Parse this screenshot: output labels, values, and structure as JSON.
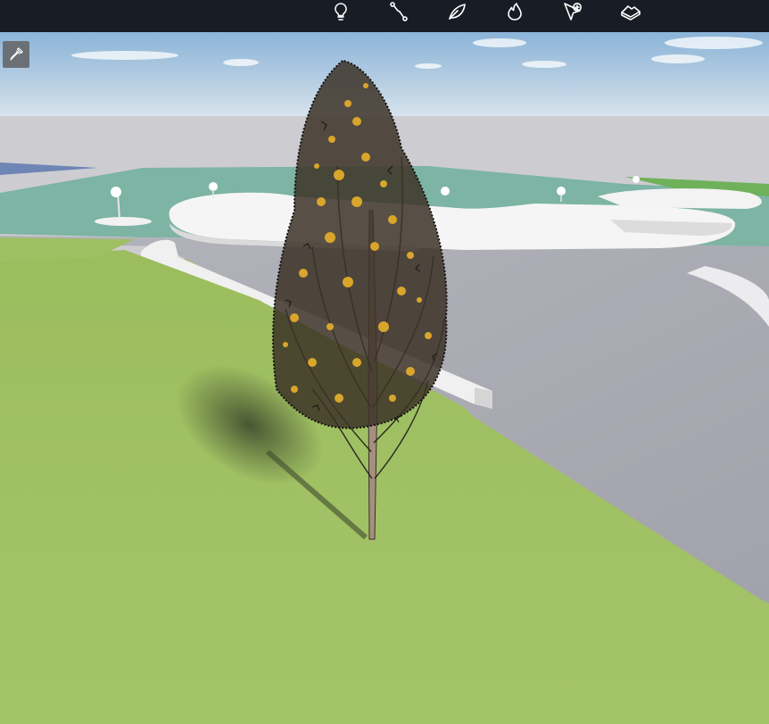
{
  "toolbar": {
    "background": "#181c25",
    "tools": [
      {
        "name": "light-tool",
        "icon": "lightbulb-icon"
      },
      {
        "name": "path-tool",
        "icon": "path-nodes-icon"
      },
      {
        "name": "vegetation-tool",
        "icon": "leaf-icon"
      },
      {
        "name": "fire-tool",
        "icon": "flame-icon"
      },
      {
        "name": "add-object-tool",
        "icon": "cursor-plus-icon"
      },
      {
        "name": "terrain-tool",
        "icon": "terrain-layers-icon"
      }
    ]
  },
  "side_tools": {
    "eyedropper": {
      "icon": "eyedropper-icon",
      "background": "#6b7077"
    }
  },
  "scene": {
    "description_colors": {
      "sky_top": "#8fb6d9",
      "sky_horizon": "#d9e4ee",
      "ground_far": "#cfcdd2",
      "grass": "#a3c266",
      "road": "#a7a7b1",
      "water_plaza": "#7fb7a8",
      "white_structure": "#f4f4f4",
      "foliage_yellow": "#d9a52b"
    }
  }
}
